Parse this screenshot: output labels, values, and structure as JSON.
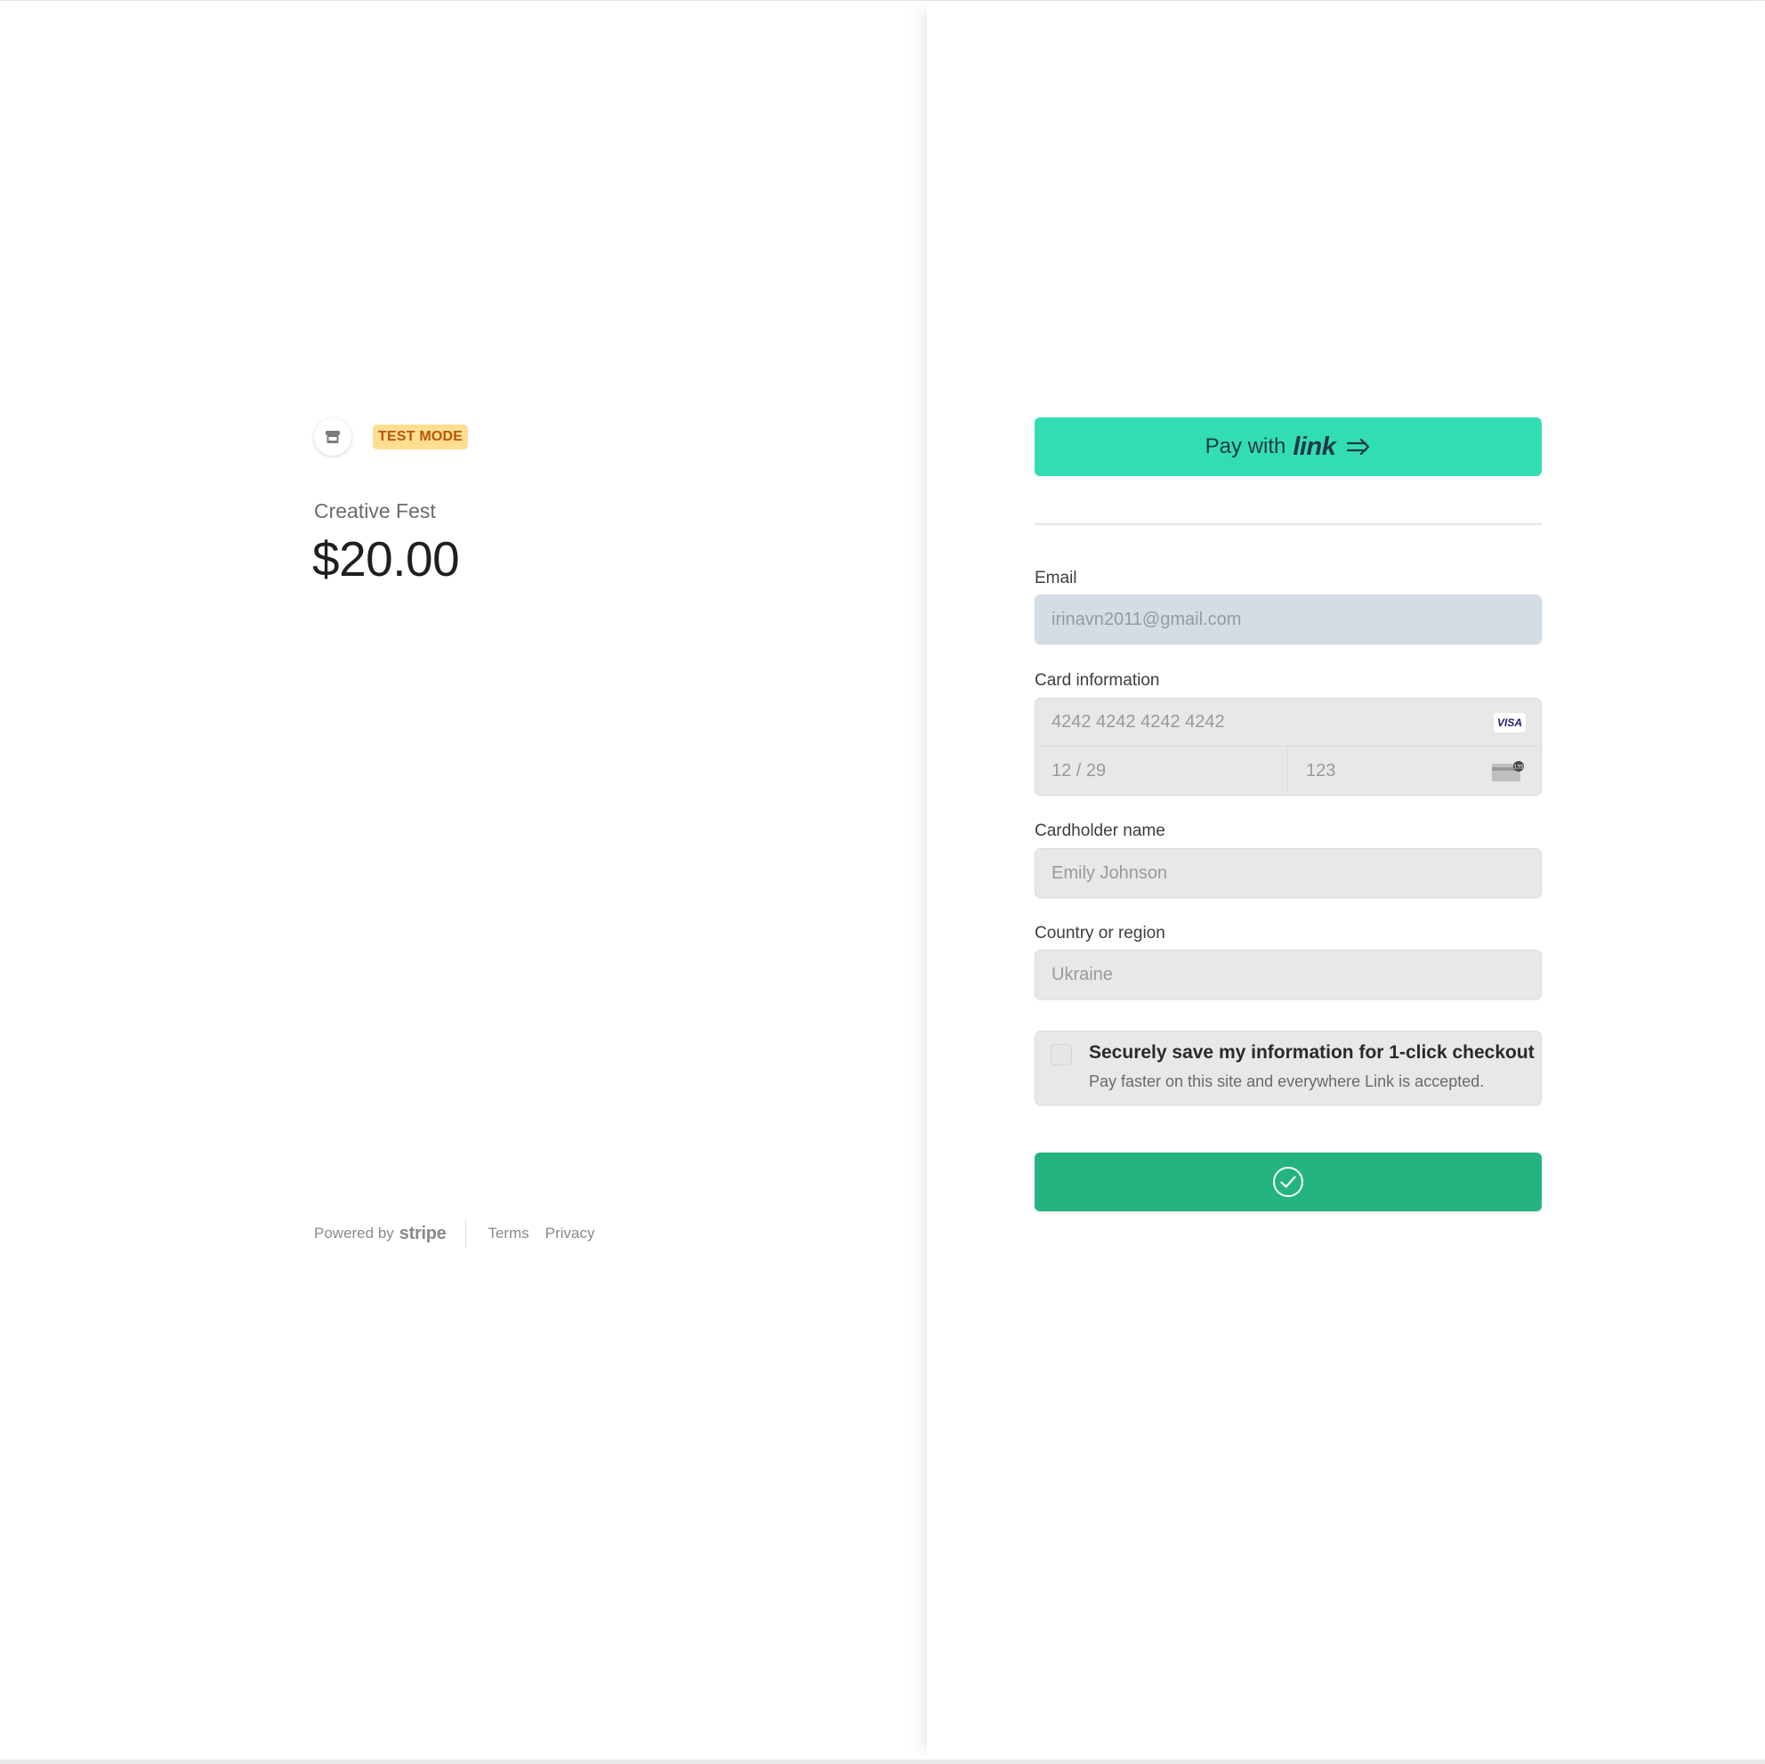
{
  "left": {
    "badge": "TEST MODE",
    "product_name": "Creative Fest",
    "price": "$20.00"
  },
  "footer": {
    "powered_by": "Powered by",
    "brand": "stripe",
    "terms": "Terms",
    "privacy": "Privacy"
  },
  "link_button": {
    "label": "Pay with",
    "brand": "link"
  },
  "form": {
    "email_label": "Email",
    "email_value": "irinavn2011@gmail.com",
    "card_label": "Card information",
    "card_number": "4242 4242 4242 4242",
    "card_brand": "VISA",
    "expiry": "12 / 29",
    "cvc": "123",
    "cvc_icon_text": "135",
    "name_label": "Cardholder name",
    "name_value": "Emily Johnson",
    "country_label": "Country or region",
    "country_value": "Ukraine",
    "save_title": "Securely save my information for 1-click checkout",
    "save_subtitle": "Pay faster on this site and everywhere Link is accepted.",
    "save_checked": false
  },
  "pay_button": {
    "state": "success",
    "icon": "check-circle-icon"
  },
  "colors": {
    "link_green": "#33ddb3",
    "pay_green": "#24b47e",
    "badge_bg": "#ffde92",
    "badge_text": "#bb5504"
  }
}
